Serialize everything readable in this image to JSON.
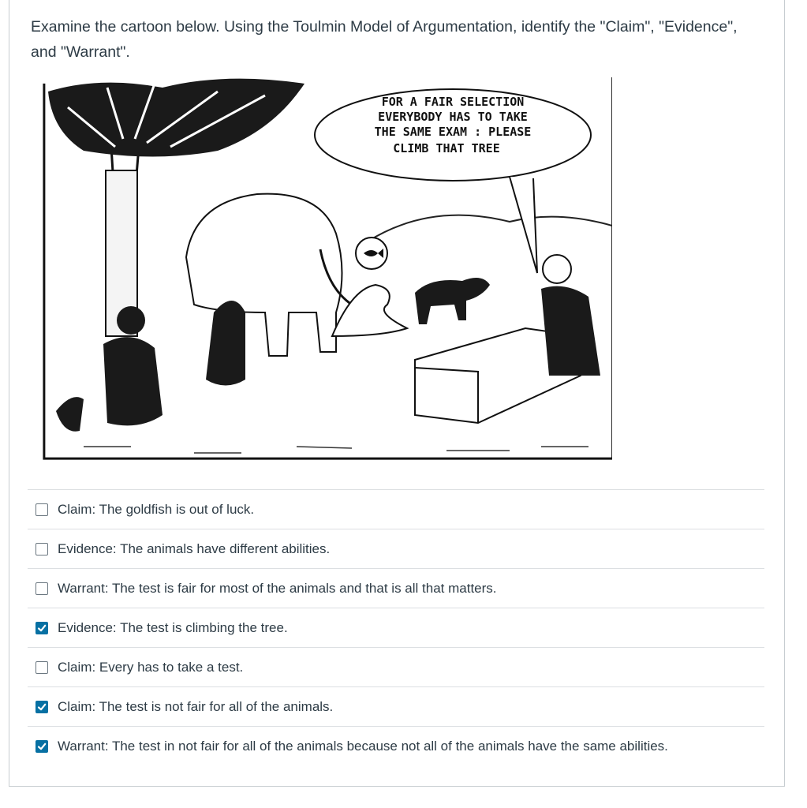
{
  "question": {
    "text": "Examine the cartoon below. Using the Toulmin Model of Argumentation, identify the \"Claim\", \"Evidence\", and \"Warrant\"."
  },
  "cartoon": {
    "speech_bubble": [
      "FOR A FAIR SELECTION",
      "EVERYBODY HAS TO TAKE",
      "THE SAME EXAM :  PLEASE",
      "CLIMB THAT TREE"
    ]
  },
  "answers": [
    {
      "label": "Claim: The goldfish is out of luck.",
      "checked": false
    },
    {
      "label": "Evidence: The animals have different abilities.",
      "checked": false
    },
    {
      "label": "Warrant: The test is fair for most of the animals and that is all that matters.",
      "checked": false
    },
    {
      "label": "Evidence: The test is climbing the tree.",
      "checked": true
    },
    {
      "label": "Claim: Every has to take a test.",
      "checked": false
    },
    {
      "label": "Claim: The test is not fair for all of the animals.",
      "checked": true
    },
    {
      "label": "Warrant: The test in not fair for all of the animals because not all of the animals have the same abilities.",
      "checked": true
    }
  ],
  "colors": {
    "checkbox_checked": "#0770a3",
    "text": "#2d3b45",
    "divider": "#dcdfe2"
  }
}
